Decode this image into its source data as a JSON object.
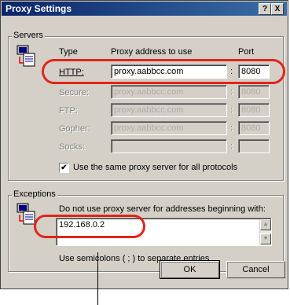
{
  "window": {
    "title": "Proxy Settings",
    "help_glyph": "?",
    "close_glyph": "X"
  },
  "servers": {
    "group_label": "Servers",
    "col_type": "Type",
    "col_address": "Proxy address to use",
    "col_port": "Port",
    "rows": [
      {
        "label": "HTTP:",
        "address": "proxy.aabbcc.com",
        "port": "8080",
        "enabled": true
      },
      {
        "label": "Secure:",
        "address": "proxy.aabbcc.com",
        "port": "8080",
        "enabled": false
      },
      {
        "label": "FTP:",
        "address": "proxy.aabbcc.com",
        "port": "8080",
        "enabled": false
      },
      {
        "label": "Gopher:",
        "address": "proxy.aabbcc.com",
        "port": "8080",
        "enabled": false
      },
      {
        "label": "Socks:",
        "address": "",
        "port": "",
        "enabled": false
      }
    ],
    "colon": ":",
    "same_proxy_label": "Use the same proxy server for all protocols",
    "same_proxy_checked": true,
    "check_glyph": "✔"
  },
  "exceptions": {
    "group_label": "Exceptions",
    "instruction": "Do not use proxy server for addresses beginning with:",
    "value": "192.168.0.2",
    "hint": "Use semicolons ( ; ) to separate entries."
  },
  "buttons": {
    "ok": "OK",
    "cancel": "Cancel"
  },
  "highlight_color": "#e1251b"
}
